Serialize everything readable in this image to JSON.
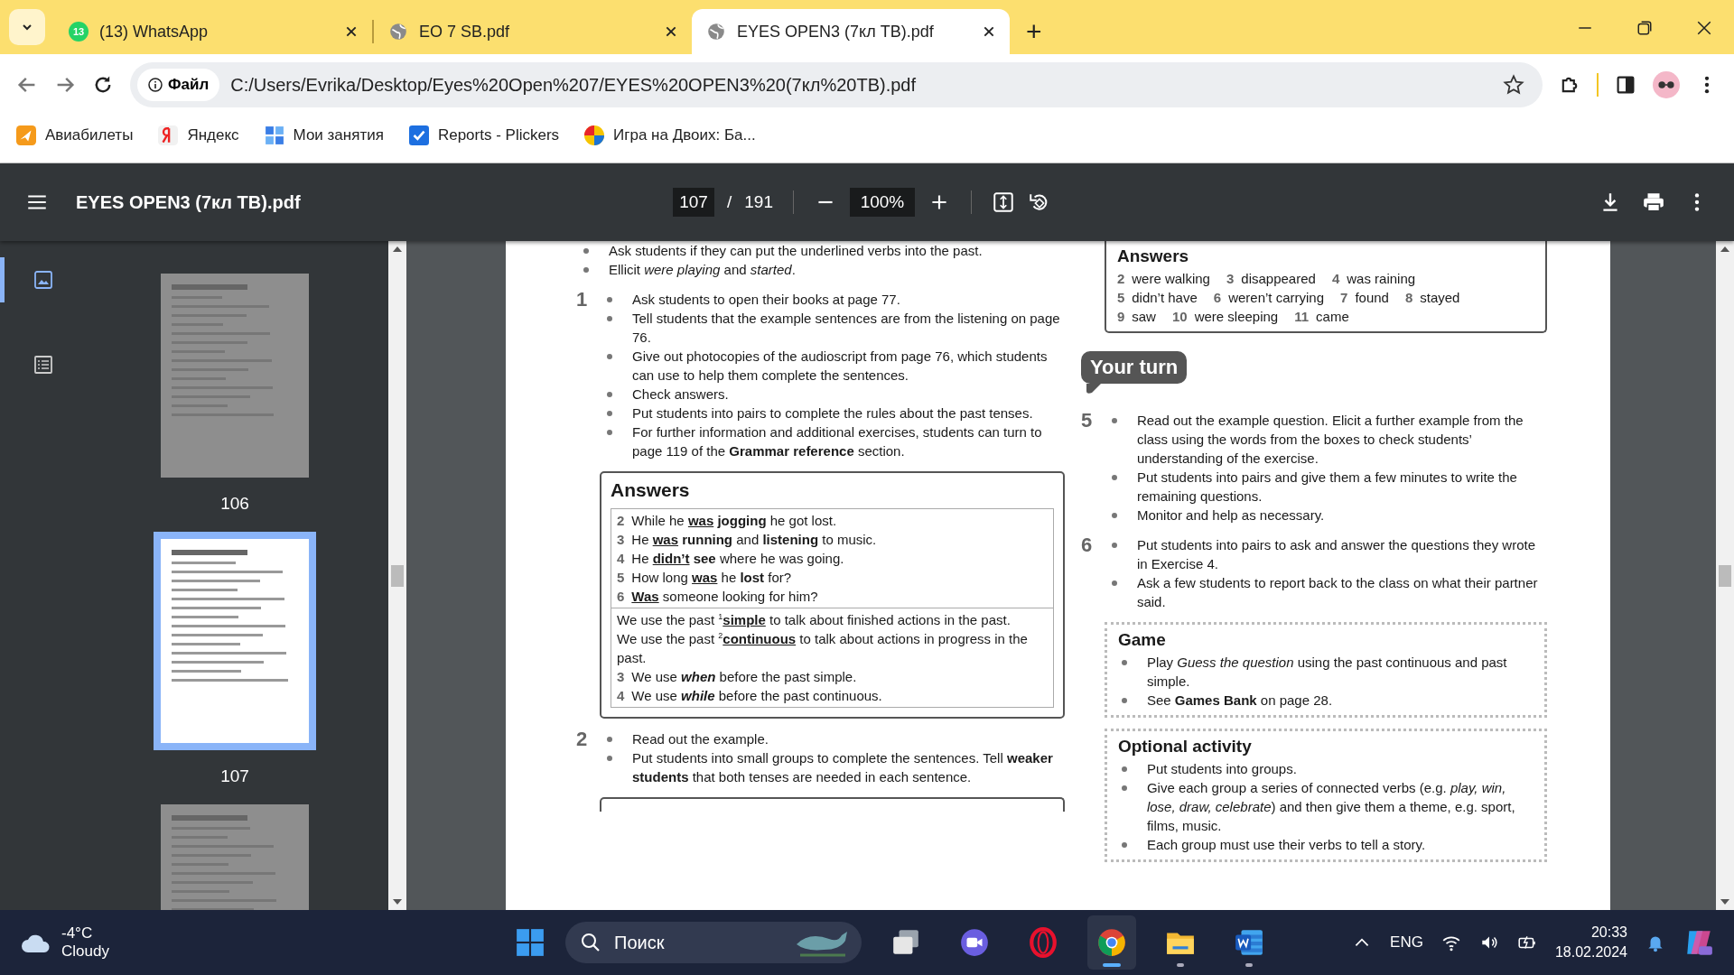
{
  "browser": {
    "tabs": [
      {
        "title": "(13) WhatsApp",
        "kind": "chat",
        "badge": "13",
        "selected": false
      },
      {
        "title": "EO 7 SB.pdf",
        "kind": "globe",
        "selected": false
      },
      {
        "title": "EYES OPEN3 (7кл ТВ).pdf",
        "kind": "globe",
        "selected": true
      }
    ],
    "new_tab": "+",
    "address": {
      "scheme": "Файл",
      "url": "C:/Users/Evrika/Desktop/Eyes%20Open%207/EYES%20OPEN3%20(7кл%20ТВ).pdf"
    },
    "bookmarks": [
      {
        "label": "Авиабилеты",
        "kind": "plane"
      },
      {
        "label": "Яндекс",
        "kind": "yandex"
      },
      {
        "label": "Мои занятия",
        "kind": "grid"
      },
      {
        "label": "Reports - Plickers",
        "kind": "check"
      },
      {
        "label": "Игра на Двоих: Ба...",
        "kind": "ball"
      }
    ]
  },
  "pdf_toolbar": {
    "title": "EYES OPEN3 (7кл ТВ).pdf",
    "page": "107",
    "page_separator": "/",
    "page_count": "191",
    "zoom": "100%"
  },
  "sidebar_views": [
    {
      "kind": "thumbnails",
      "selected": true
    },
    {
      "kind": "outline",
      "selected": false
    }
  ],
  "thumbnails": [
    {
      "label": "106",
      "selected": false
    },
    {
      "label": "107",
      "selected": true
    },
    {
      "selected": false
    }
  ],
  "document": {
    "left": [
      {
        "kind": "bullets",
        "items": [
          "Ask students if they can put the underlined verbs into the past.",
          "Ellicit *were playing* and *started*."
        ]
      },
      {
        "kind": "bullets",
        "number": "1",
        "items": [
          "Ask students to open their books at page 77.",
          "Tell students that the example sentences are from the listening on page 76.",
          "Give out photocopies of the audioscript from page 76, which students can use to help them complete the sentences.",
          "Check answers.",
          "Put students into pairs to complete the rules about the past tenses.",
          "For further information and additional exercises, students can turn to page 119 of the **Grammar reference** section."
        ]
      },
      {
        "kind": "answers_table",
        "title": "Answers",
        "rows": [
          {
            "n": "2",
            "segs": [
              {
                "t": "While he "
              },
              {
                "t": "was",
                "b": true,
                "u": true
              },
              {
                "t": " jogging",
                "b": true
              },
              {
                "t": " he got lost."
              }
            ]
          },
          {
            "n": "3",
            "segs": [
              {
                "t": "He "
              },
              {
                "t": "was",
                "b": true,
                "u": true
              },
              {
                "t": " running",
                "b": true
              },
              {
                "t": " and "
              },
              {
                "t": "listening",
                "b": true
              },
              {
                "t": " to music."
              }
            ]
          },
          {
            "n": "4",
            "segs": [
              {
                "t": "He "
              },
              {
                "t": "didn’t",
                "b": true,
                "u": true
              },
              {
                "t": " see",
                "b": true
              },
              {
                "t": " where he was going."
              }
            ]
          },
          {
            "n": "5",
            "segs": [
              {
                "t": "How long "
              },
              {
                "t": "was",
                "b": true,
                "u": true
              },
              {
                "t": " he "
              },
              {
                "t": "lost",
                "b": true
              },
              {
                "t": " for?"
              }
            ]
          },
          {
            "n": "6",
            "segs": [
              {
                "t": "Was",
                "b": true,
                "u": true
              },
              {
                "t": " someone looking for him?"
              }
            ]
          }
        ],
        "rules": [
          {
            "segs": [
              {
                "t": "We use the past "
              },
              {
                "t": "1",
                "sup": true
              },
              {
                "t": "simple",
                "b": true,
                "u": true
              },
              {
                "t": " to talk about finished actions in the past."
              }
            ]
          },
          {
            "segs": [
              {
                "t": "We use the past "
              },
              {
                "t": "2",
                "sup": true
              },
              {
                "t": "continuous",
                "b": true,
                "u": true
              },
              {
                "t": " to talk about actions in progress in the past."
              }
            ]
          },
          {
            "n": "3",
            "segs": [
              {
                "t": "We use "
              },
              {
                "t": "when",
                "b": true,
                "i": true
              },
              {
                "t": " before the past simple."
              }
            ]
          },
          {
            "n": "4",
            "segs": [
              {
                "t": "We use "
              },
              {
                "t": "while",
                "b": true,
                "i": true
              },
              {
                "t": " before the past continuous."
              }
            ]
          }
        ]
      },
      {
        "kind": "bullets",
        "number": "2",
        "items": [
          "Read out the example.",
          "Put students into small groups to complete the sentences. Tell **weaker students** that both tenses are needed in each sentence."
        ]
      },
      {
        "kind": "box_edge"
      }
    ],
    "right": [
      {
        "kind": "answers_inline",
        "title": "Answers",
        "lines": [
          [
            {
              "n": "2",
              "t": "were walking"
            },
            {
              "n": "3",
              "t": "disappeared"
            },
            {
              "n": "4",
              "t": "was raining"
            }
          ],
          [
            {
              "n": "5",
              "t": "didn’t have"
            },
            {
              "n": "6",
              "t": "weren’t carrying"
            },
            {
              "n": "7",
              "t": "found"
            },
            {
              "n": "8",
              "t": "stayed"
            }
          ],
          [
            {
              "n": "9",
              "t": "saw"
            },
            {
              "n": "10",
              "t": "were sleeping"
            },
            {
              "n": "11",
              "t": "came"
            }
          ]
        ]
      },
      {
        "kind": "label",
        "text": "Your turn"
      },
      {
        "kind": "bullets",
        "number": "5",
        "items": [
          "Read out the example question. Elicit a further example from the class using the words from the boxes to check students’ understanding of the exercise.",
          "Put students into pairs and give them a few minutes to write the remaining questions.",
          "Monitor and help as necessary."
        ]
      },
      {
        "kind": "bullets",
        "number": "6",
        "items": [
          "Put students into pairs to ask and answer the questions they wrote in Exercise 4.",
          "Ask a few students to report back to the class on what their partner said."
        ]
      },
      {
        "kind": "boxed",
        "title": "Game",
        "items": [
          "Play *Guess the question* using the past continuous and past simple.",
          "See **Games Bank** on page 28."
        ]
      },
      {
        "kind": "boxed",
        "title": "Optional activity",
        "items": [
          "Put students into groups.",
          "Give each group a series of connected verbs (e.g. *play, win, lose, draw, celebrate*) and then give them a theme, e.g. sport, films, music.",
          "Each group must use their verbs to tell a story."
        ]
      }
    ]
  },
  "taskbar": {
    "weather": {
      "temp": "-4°C",
      "condition": "Cloudy"
    },
    "search": {
      "placeholder": "Поиск"
    },
    "apps": [
      {
        "kind": "task-view",
        "running": false,
        "selected": false
      },
      {
        "kind": "meet",
        "running": false,
        "selected": false
      },
      {
        "kind": "opera",
        "running": false,
        "selected": false
      },
      {
        "kind": "chrome",
        "running": true,
        "selected": true
      },
      {
        "kind": "explorer",
        "running": true,
        "selected": false
      },
      {
        "kind": "word",
        "running": true,
        "selected": false
      }
    ],
    "language": "ENG",
    "time": "20:33",
    "date": "18.02.2024"
  }
}
